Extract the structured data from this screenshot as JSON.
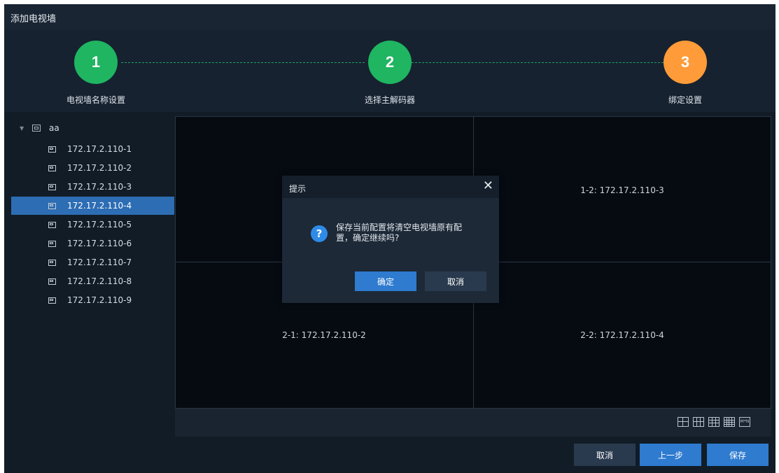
{
  "window": {
    "title": "添加电视墙"
  },
  "steps": [
    {
      "number": "1",
      "label": "电视墙名称设置",
      "color": "#1fb561"
    },
    {
      "number": "2",
      "label": "选择主解码器",
      "color": "#1fb561"
    },
    {
      "number": "3",
      "label": "绑定设置",
      "color": "#ff9b38"
    }
  ],
  "tree": {
    "root": {
      "label": "aa"
    },
    "items": [
      {
        "label": "172.17.2.110-1"
      },
      {
        "label": "172.17.2.110-2"
      },
      {
        "label": "172.17.2.110-3"
      },
      {
        "label": "172.17.2.110-4",
        "selected": true
      },
      {
        "label": "172.17.2.110-5"
      },
      {
        "label": "172.17.2.110-6"
      },
      {
        "label": "172.17.2.110-7"
      },
      {
        "label": "172.17.2.110-8"
      },
      {
        "label": "172.17.2.110-9"
      }
    ]
  },
  "wall": {
    "cells": [
      {
        "label": ""
      },
      {
        "label": "1-2: 172.17.2.110-3"
      },
      {
        "label": "2-1: 172.17.2.110-2"
      },
      {
        "label": "2-2: 172.17.2.110-4"
      }
    ],
    "layout_icons": [
      "grid-2x2-icon",
      "grid-3x2-icon",
      "grid-3x3-icon",
      "grid-4x4-icon",
      "custom-mxn-icon"
    ],
    "custom_layout_text": "M*N"
  },
  "footer": {
    "cancel_label": "取消",
    "prev_label": "上一步",
    "save_label": "保存"
  },
  "dialog": {
    "title": "提示",
    "close_glyph": "✕",
    "icon_glyph": "?",
    "message": "保存当前配置将清空电视墙原有配置，确定继续吗?",
    "ok_label": "确定",
    "cancel_label": "取消"
  },
  "colors": {
    "accent_blue": "#2e7bd0",
    "step_green": "#1fb561",
    "step_orange": "#ff9b38",
    "selection": "#2d6db4"
  }
}
